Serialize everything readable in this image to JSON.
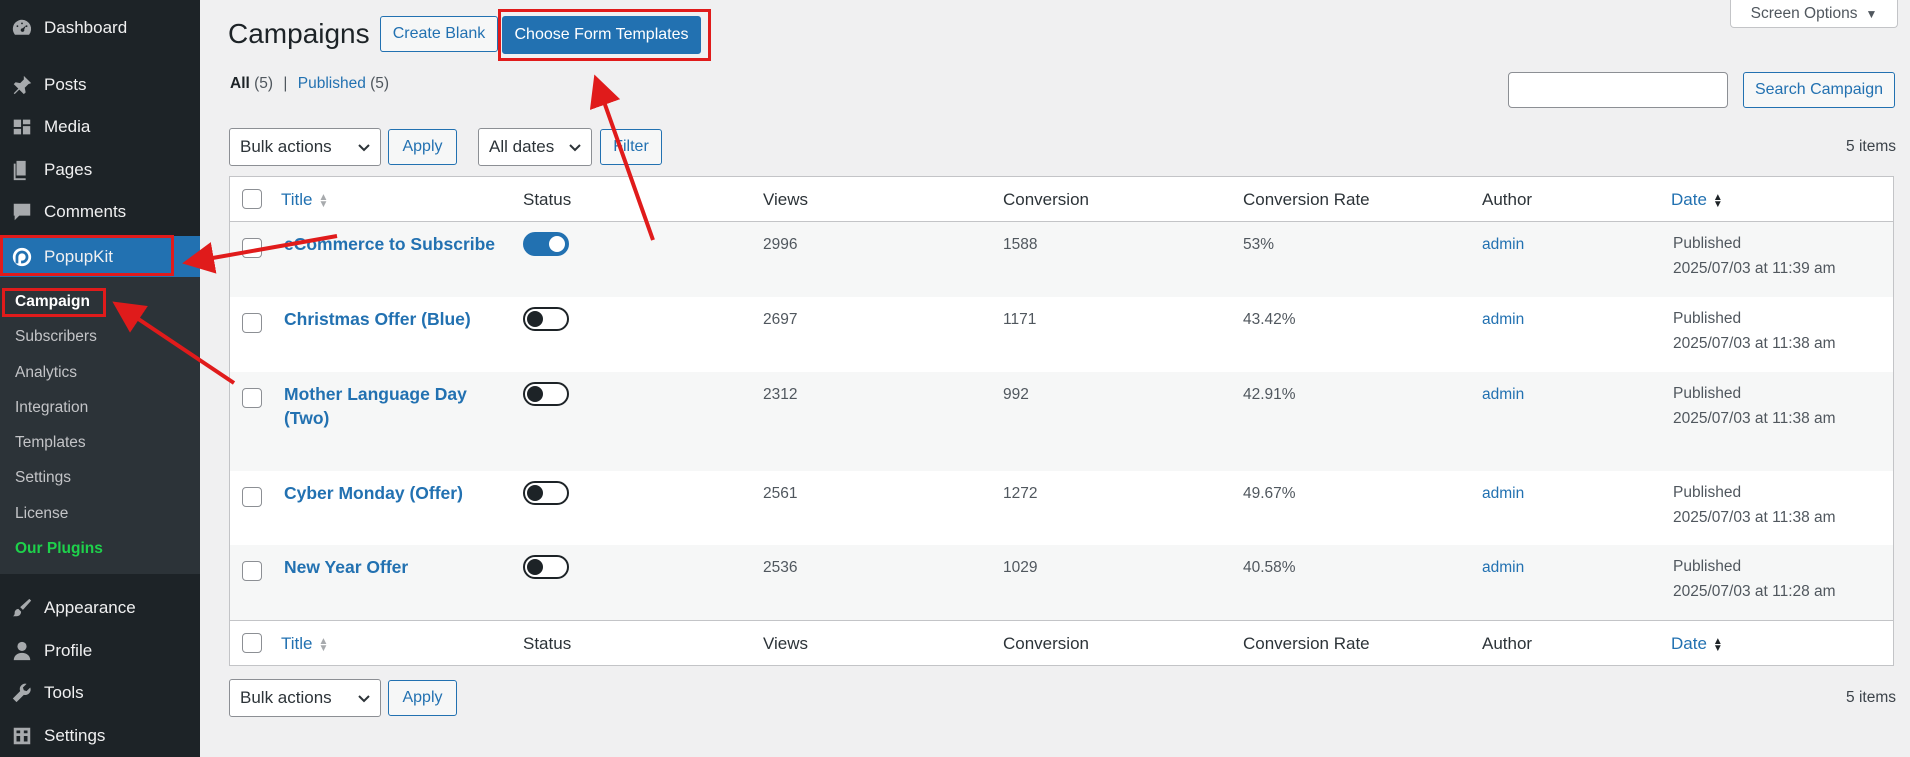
{
  "sidebar": {
    "top_items": [
      {
        "label": "Dashboard",
        "icon": "dashboard-icon"
      },
      {
        "label": "Posts",
        "icon": "pin-icon"
      },
      {
        "label": "Media",
        "icon": "media-icon"
      },
      {
        "label": "Pages",
        "icon": "pages-icon"
      },
      {
        "label": "Comments",
        "icon": "comment-icon"
      }
    ],
    "plugin_item": {
      "label": "PopupKit",
      "icon": "popupkit-icon"
    },
    "submenu": [
      "Campaign",
      "Subscribers",
      "Analytics",
      "Integration",
      "Templates",
      "Settings",
      "License",
      "Our Plugins"
    ],
    "bottom_items": [
      {
        "label": "Appearance",
        "icon": "brush-icon"
      },
      {
        "label": "Profile",
        "icon": "user-icon"
      },
      {
        "label": "Tools",
        "icon": "wrench-icon"
      },
      {
        "label": "Settings",
        "icon": "settings-icon"
      }
    ]
  },
  "header": {
    "title": "Campaigns",
    "create_blank": "Create Blank",
    "choose_templates": "Choose Form Templates",
    "screen_options": "Screen Options"
  },
  "filters": {
    "all_label": "All",
    "all_count": "(5)",
    "separator": "|",
    "published_label": "Published",
    "published_count": "(5)"
  },
  "search": {
    "value": "",
    "button": "Search Campaign"
  },
  "toolbar": {
    "bulk_actions": "Bulk actions",
    "apply": "Apply",
    "all_dates": "All dates",
    "filter": "Filter",
    "items_count": "5 items"
  },
  "table": {
    "columns": [
      "Title",
      "Status",
      "Views",
      "Conversion",
      "Conversion Rate",
      "Author",
      "Date"
    ],
    "rows": [
      {
        "title": "eCommerce to Subscribe",
        "status_on": true,
        "views": "2996",
        "conversion": "1588",
        "rate": "53%",
        "author": "admin",
        "date_status": "Published",
        "date": "2025/07/03 at 11:39 am"
      },
      {
        "title": "Christmas Offer (Blue)",
        "status_on": false,
        "views": "2697",
        "conversion": "1171",
        "rate": "43.42%",
        "author": "admin",
        "date_status": "Published",
        "date": "2025/07/03 at 11:38 am"
      },
      {
        "title": "Mother Language Day (Two)",
        "status_on": false,
        "views": "2312",
        "conversion": "992",
        "rate": "42.91%",
        "author": "admin",
        "date_status": "Published",
        "date": "2025/07/03 at 11:38 am"
      },
      {
        "title": "Cyber Monday (Offer)",
        "status_on": false,
        "views": "2561",
        "conversion": "1272",
        "rate": "49.67%",
        "author": "admin",
        "date_status": "Published",
        "date": "2025/07/03 at 11:38 am"
      },
      {
        "title": "New Year Offer",
        "status_on": false,
        "views": "2536",
        "conversion": "1029",
        "rate": "40.58%",
        "author": "admin",
        "date_status": "Published",
        "date": "2025/07/03 at 11:28 am"
      }
    ]
  },
  "colors": {
    "accent": "#2271b1",
    "sidebar": "#1d2327",
    "annotation": "#e01b1b",
    "our_plugins": "#1ed14b"
  }
}
